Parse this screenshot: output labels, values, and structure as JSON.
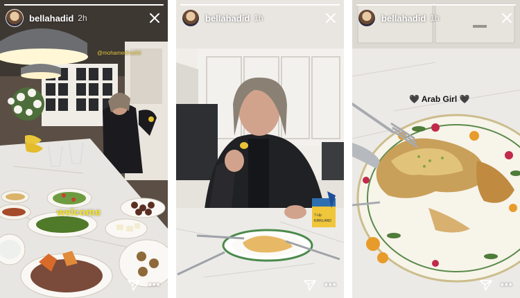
{
  "stories": [
    {
      "username": "bellahadid",
      "time": "2h",
      "progress": 1.0,
      "mention": "@mohamedhadid",
      "sticker_text": "welcome"
    },
    {
      "username": "bellahadid",
      "time": "1h",
      "progress": 1.0,
      "pack_label": "7-Up\nKIRKLAND"
    },
    {
      "username": "bellahadid",
      "time": "1h",
      "progress": 1.0,
      "caption": "🖤 Arab Girl 🖤"
    }
  ],
  "icons": {
    "close": "close-icon",
    "send": "send-icon",
    "more": "more-icon"
  },
  "colors": {
    "text_overlay": "#ffffff",
    "welcome_text": "#f2e025",
    "mention_text": "#f2d34a"
  }
}
